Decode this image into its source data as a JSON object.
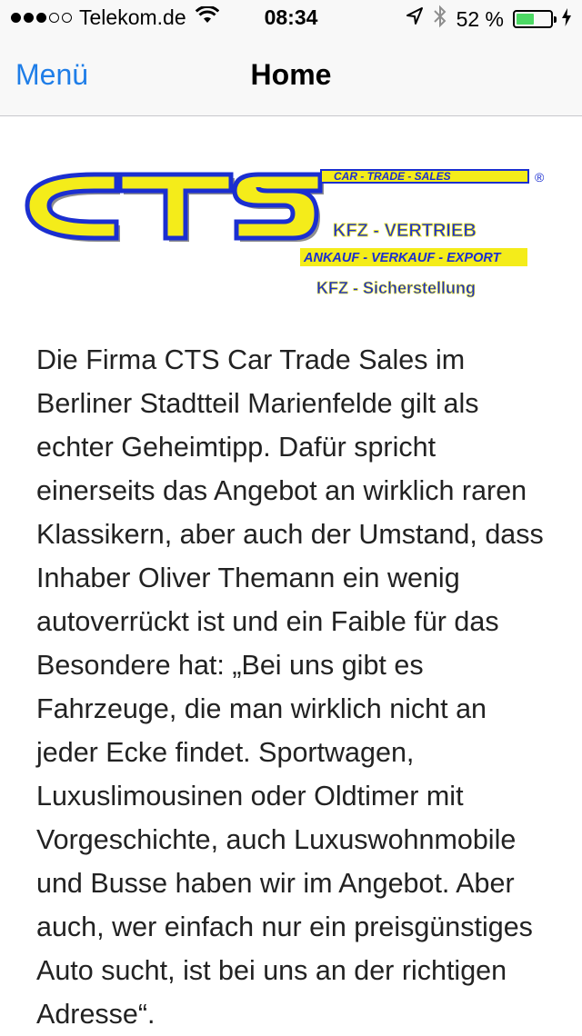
{
  "status_bar": {
    "carrier": "Telekom.de",
    "time": "08:34",
    "battery_percent": "52 %",
    "battery_level": 0.52,
    "signal_bars_filled": 3,
    "signal_bars_total": 5,
    "icons": [
      "wifi-icon",
      "location-icon",
      "bluetooth-icon",
      "battery-icon",
      "charging-icon"
    ]
  },
  "nav": {
    "back_label": "Menü",
    "title": "Home"
  },
  "logo": {
    "wordmark": "CTS",
    "tagline": "CAR - TRADE - SALES",
    "registered": "®",
    "line1": "KFZ - VERTRIEB",
    "line2": "ANKAUF - VERKAUF - EXPORT",
    "line3": "KFZ - Sicherstellung",
    "colors": {
      "yellow": "#f4ec1a",
      "blue": "#1b2fd0",
      "shadow": "#8f8f8f"
    }
  },
  "article": {
    "text": "Die Firma CTS Car Trade Sales im Berliner Stadtteil Marienfelde gilt als echter Geheimtipp. Dafür spricht einerseits das Angebot an wirklich raren Klassikern, aber auch der Umstand, dass Inhaber Oliver Themann ein wenig autoverrückt ist und ein Faible für das Besondere hat: „Bei uns gibt es Fahrzeuge, die man wirklich nicht an jeder Ecke findet. Sportwagen, Luxuslimousinen oder Oldtimer mit Vorgeschichte, auch Luxuswohnmobile und Busse haben wir im Angebot. Aber auch, wer einfach nur ein preisgünstiges Auto sucht, ist bei uns an der richtigen Adresse“."
  },
  "theme": {
    "accent": "#1f7ee8",
    "bar_background": "#f8f8f8",
    "battery_green": "#4cd964"
  }
}
